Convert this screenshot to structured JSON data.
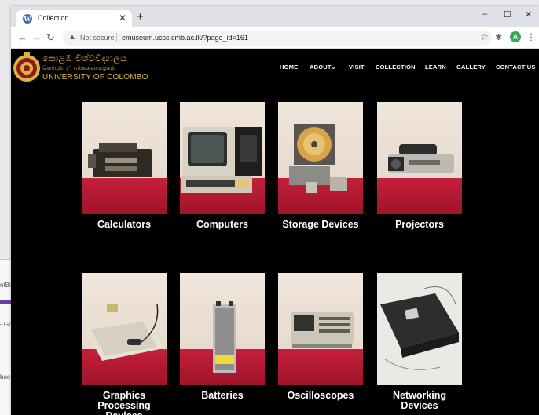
{
  "browser": {
    "tab_title": "Collection",
    "tab_close": "✕",
    "new_tab": "+",
    "window_controls": {
      "minimize": "–",
      "maximize": "☐",
      "close": "✕"
    },
    "not_secure": "Not secure",
    "url": "emuseum.ucsc.cmb.ac.lk/?page_id=161",
    "avatar_letter": "A"
  },
  "background_window": {
    "lines": [
      "ntBi",
      "- Gr",
      "bac"
    ]
  },
  "site": {
    "logo": {
      "line1": "කොළඹ විශ්වවිද්‍යාලය",
      "line2": "கொழும்புப் பல்கலைக்கழகம்",
      "line3": "UNIVERSITY OF COLOMBO"
    },
    "nav": [
      {
        "label": "HOME"
      },
      {
        "label": "ABOUT"
      },
      {
        "label": "VISIT"
      },
      {
        "label": "COLLECTION"
      },
      {
        "label": "LEARN"
      },
      {
        "label": "GALLERY"
      },
      {
        "label": "CONTACT US"
      }
    ],
    "categories": [
      {
        "label": "Calculators"
      },
      {
        "label": "Computers"
      },
      {
        "label": "Storage Devices"
      },
      {
        "label": "Projectors"
      },
      {
        "label": "Graphics Processing Devices"
      },
      {
        "label": "Batteries"
      },
      {
        "label": "Oscilloscopes"
      },
      {
        "label": "Networking Devices"
      }
    ]
  },
  "colors": {
    "page_bg": "#000000",
    "logo_gold": "#d9b53c",
    "cloth_red": "#c61f3c",
    "tab_bar": "#dee1e6"
  }
}
